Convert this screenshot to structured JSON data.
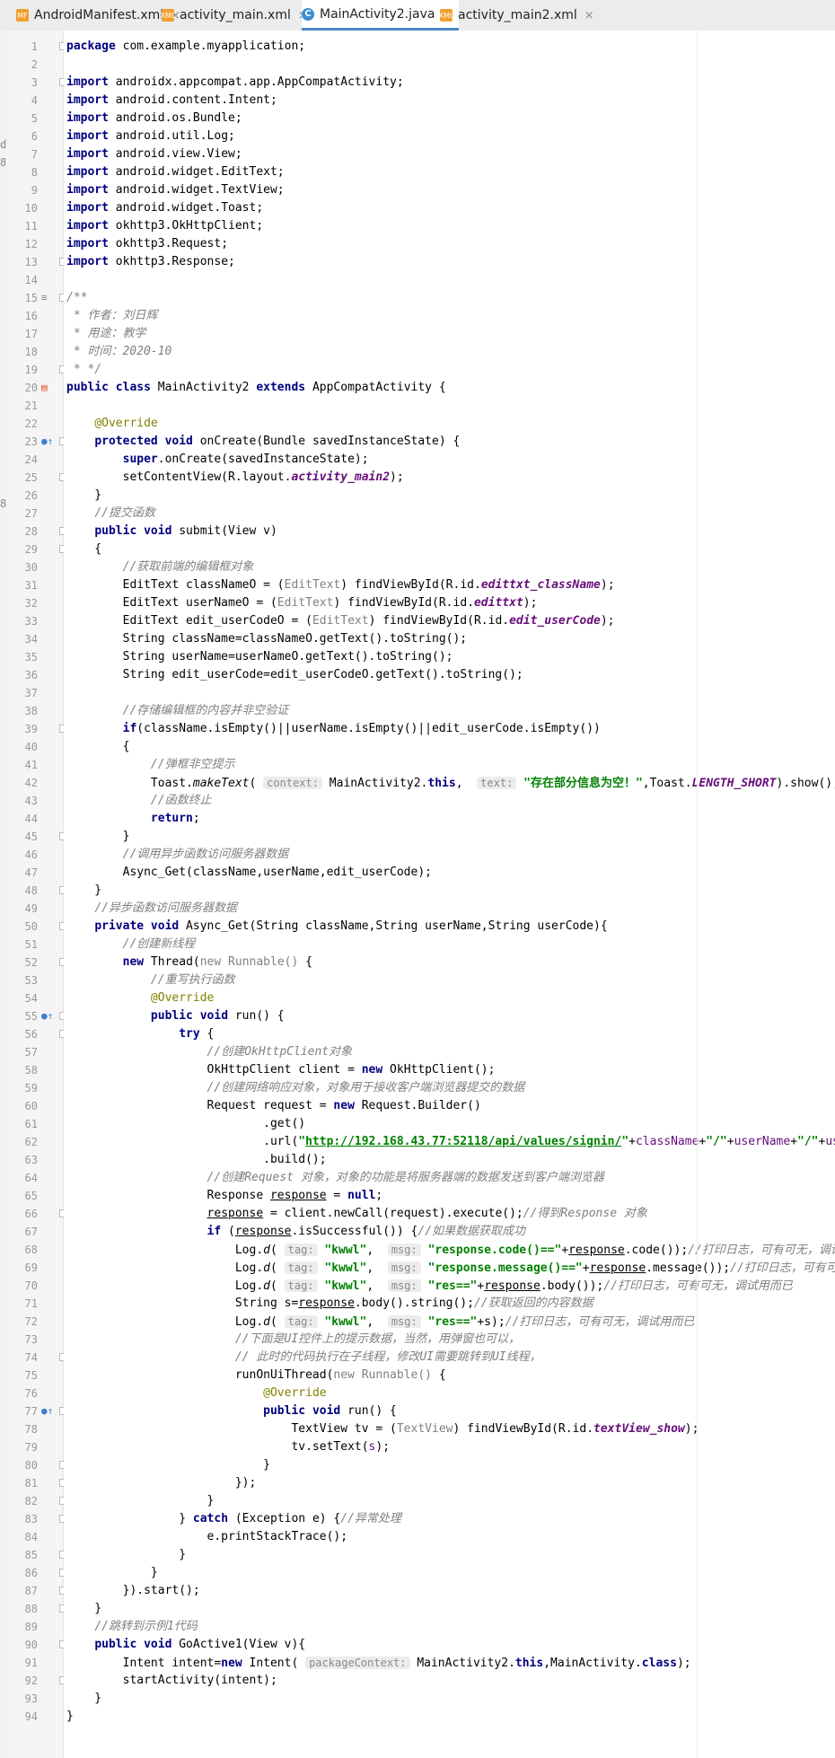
{
  "tabs": [
    {
      "label": "AndroidManifest.xml",
      "icon": "xml-file-icon",
      "badge": "MF",
      "active": false
    },
    {
      "label": "activity_main.xml",
      "icon": "xml-file-icon",
      "badge": "XML",
      "active": false
    },
    {
      "label": "MainActivity2.java",
      "icon": "java-class-icon",
      "badge": "C",
      "active": true
    },
    {
      "label": "activity_main2.xml",
      "icon": "xml-file-icon",
      "badge": "XML",
      "active": false
    }
  ],
  "tab_close_glyph": "×",
  "left_edge_glyphs": [
    "dT",
    "8",
    "8"
  ],
  "colors": {
    "keyword": "#000080",
    "comment": "#808080",
    "annotation": "#808000",
    "string": "#008000",
    "field": "#660e7a",
    "active_tab_underline": "#4a88c7"
  },
  "code_lines": [
    "<span class=\"kw\">package</span> com.example.myapplication;",
    "",
    "<span class=\"kw\">import</span> androidx.appcompat.app.AppCompatActivity;",
    "<span class=\"kw\">import</span> android.content.Intent;",
    "<span class=\"kw\">import</span> android.os.Bundle;",
    "<span class=\"kw\">import</span> android.util.Log;",
    "<span class=\"kw\">import</span> android.view.View;",
    "<span class=\"kw\">import</span> android.widget.EditText;",
    "<span class=\"kw\">import</span> android.widget.TextView;",
    "<span class=\"kw\">import</span> android.widget.Toast;",
    "<span class=\"kw\">import</span> okhttp3.OkHttpClient;",
    "<span class=\"kw\">import</span> okhttp3.Request;",
    "<span class=\"kw\">import</span> okhttp3.Response;",
    "",
    "<span class=\"cm\">/**</span>",
    "<span class=\"cm\"> * 作者：刘日辉</span>",
    "<span class=\"cm\"> * 用途：教学</span>",
    "<span class=\"cm\"> * 时间：2020-10</span>",
    "<span class=\"cm\"> * */</span>",
    "<span class=\"kw\">public class</span> MainActivity2 <span class=\"kw\">extends</span> AppCompatActivity {",
    "",
    "    <span class=\"ann\">@Override</span>",
    "    <span class=\"kw\">protected void</span> onCreate(Bundle savedInstanceState) {",
    "        <span class=\"kw\">super</span>.onCreate(savedInstanceState);",
    "        setContentView(R.layout.<span class=\"fld\">activity_main2</span>);",
    "    }",
    "    <span class=\"cm\">//提交函数</span>",
    "    <span class=\"kw\">public void</span> submit(View v)",
    "    {",
    "        <span class=\"cm\">//获取前端的编辑框对象</span>",
    "        EditText classNameO = (<span class=\"gray\">EditText</span>) findViewById(R.id.<span class=\"fld\">edittxt_className</span>);",
    "        EditText userNameO = (<span class=\"gray\">EditText</span>) findViewById(R.id.<span class=\"fld\">edittxt</span>);",
    "        EditText edit_userCodeO = (<span class=\"gray\">EditText</span>) findViewById(R.id.<span class=\"fld\">edit_userCode</span>);",
    "        String className=classNameO.getText().toString();",
    "        String userName=userNameO.getText().toString();",
    "        String edit_userCode=edit_userCodeO.getText().toString();",
    "",
    "        <span class=\"cm\">//存储编辑框的内容并非空验证</span>",
    "        <span class=\"kw\">if</span>(className.isEmpty()||userName.isEmpty()||edit_userCode.isEmpty())",
    "        {",
    "            <span class=\"cm\">//弹框非空提示</span>",
    "            Toast.<span class=\"st\">makeText</span>( <span class=\"hint\">context:</span> MainActivity2.<span class=\"kw\">this</span>,  <span class=\"hint\">text:</span> <span class=\"str\">\"存在部分信息为空！\"</span>,Toast.<span class=\"fld\">LENGTH_SHORT</span>).show();",
    "            <span class=\"cm\">//函数终止</span>",
    "            <span class=\"kw\">return</span>;",
    "        }",
    "        <span class=\"cm\">//调用异步函数访问服务器数据</span>",
    "        Async_Get(className,userName,edit_userCode);",
    "    }",
    "    <span class=\"cm\">//异步函数访问服务器数据</span>",
    "    <span class=\"kw\">private void</span> Async_Get(String className,String userName,String userCode){",
    "        <span class=\"cm\">//创建新线程</span>",
    "        <span class=\"kw\">new</span> Thread(<span class=\"gray\">new Runnable()</span> {",
    "            <span class=\"cm\">//重写执行函数</span>",
    "            <span class=\"ann\">@Override</span>",
    "            <span class=\"kw\">public void</span> run() {",
    "                <span class=\"kw\">try</span> {",
    "                    <span class=\"cm\">//创建OkHttpClient对象</span>",
    "                    OkHttpClient client = <span class=\"kw\">new</span> OkHttpClient();",
    "                    <span class=\"cm\">//创建网络响应对象，对象用于接收客户端浏览器提交的数据</span>",
    "                    Request request = <span class=\"kw\">new</span> Request.Builder()",
    "                            .get()",
    "                            .url(<span class=\"str\">\"<span class=\"link\">http://192.168.43.77:52118/api/values/signin/</span>\"</span>+<span class=\"purp\">className</span>+<span class=\"str\">\"/\"</span>+<span class=\"purp\">userName</span>+<span class=\"str\">\"/\"</span>+<span class=\"purp\">userCode</span>)",
    "                            .build();",
    "                    <span class=\"cm\">//创建Request 对象，对象的功能是将服务器端的数据发送到客户端浏览器</span>",
    "                    Response <span class=\"ul\">response</span> = <span class=\"kw\">null</span>;",
    "                    <span class=\"ul\">response</span> = client.newCall(request).execute();<span class=\"cm\">//得到Response 对象</span>",
    "                    <span class=\"kw\">if</span> (<span class=\"ul\">response</span>.isSuccessful()) {<span class=\"cm\">//如果数据获取成功</span>",
    "                        Log.<span class=\"st\">d</span>( <span class=\"hint\">tag:</span> <span class=\"str\">\"kwwl\"</span>,  <span class=\"hint\">msg:</span> <span class=\"str\">\"response.code()==\"</span>+<span class=\"ul\">response</span>.code());<span class=\"cm\">//打印日志，可有可无，调试用而已</span>",
    "                        Log.<span class=\"st\">d</span>( <span class=\"hint\">tag:</span> <span class=\"str\">\"kwwl\"</span>,  <span class=\"hint\">msg:</span> <span class=\"str\">\"response.message()==\"</span>+<span class=\"ul\">response</span>.message());<span class=\"cm\">//打印日志，可有可无，调试用而已</span>",
    "                        Log.<span class=\"st\">d</span>( <span class=\"hint\">tag:</span> <span class=\"str\">\"kwwl\"</span>,  <span class=\"hint\">msg:</span> <span class=\"str\">\"res==\"</span>+<span class=\"ul\">response</span>.body());<span class=\"cm\">//打印日志，可有可无，调试用而已</span>",
    "                        String s=<span class=\"ul\">response</span>.body().string();<span class=\"cm\">//获取返回的内容数据</span>",
    "                        Log.<span class=\"st\">d</span>( <span class=\"hint\">tag:</span> <span class=\"str\">\"kwwl\"</span>,  <span class=\"hint\">msg:</span> <span class=\"str\">\"res==\"</span>+s);<span class=\"cm\">//打印日志，可有可无，调试用而已</span>",
    "                        <span class=\"cm\">//下面是UI控件上的提示数据，当然，用弹窗也可以，</span>",
    "                        <span class=\"cm\">// 此时的代码执行在子线程，修改UI需要跳转到UI线程，</span>",
    "                        runOnUiThread(<span class=\"gray\">new Runnable()</span> {",
    "                            <span class=\"ann\">@Override</span>",
    "                            <span class=\"kw\">public void</span> run() {",
    "                                TextView tv = (<span class=\"gray\">TextView</span>) findViewById(R.id.<span class=\"fld\">textView_show</span>);",
    "                                tv.setText(<span class=\"purp\">s</span>);",
    "                            }",
    "                        });",
    "                    }",
    "                } <span class=\"kw\">catch</span> (Exception e) {<span class=\"cm\">//异常处理</span>",
    "                    e.printStackTrace();",
    "                }",
    "            }",
    "        }).start();",
    "    }",
    "    <span class=\"cm\">//跳转到示例1代码</span>",
    "    <span class=\"kw\">public void</span> GoActive1(View v){",
    "        Intent intent=<span class=\"kw\">new</span> Intent( <span class=\"hint\">packageContext:</span> MainActivity2.<span class=\"kw\">this</span>,MainActivity.<span class=\"kw\">class</span>);",
    "        startActivity(intent);",
    "    }",
    "}"
  ],
  "gutter_icons": [
    {
      "line": 15,
      "name": "fold-comment-icon",
      "glyph": "≡"
    },
    {
      "line": 20,
      "name": "xml-layout-link-icon",
      "glyph": "▤"
    },
    {
      "line": 23,
      "name": "override-method-icon",
      "glyph": "●↑"
    },
    {
      "line": 55,
      "name": "implement-method-icon",
      "glyph": "●↑"
    },
    {
      "line": 77,
      "name": "implement-method-icon",
      "glyph": "●↑"
    }
  ],
  "fold_lines": [
    1,
    3,
    13,
    15,
    19,
    23,
    25,
    28,
    29,
    39,
    45,
    48,
    50,
    52,
    55,
    56,
    66,
    74,
    77,
    80,
    81,
    82,
    83,
    85,
    86,
    87,
    88,
    90,
    92
  ]
}
